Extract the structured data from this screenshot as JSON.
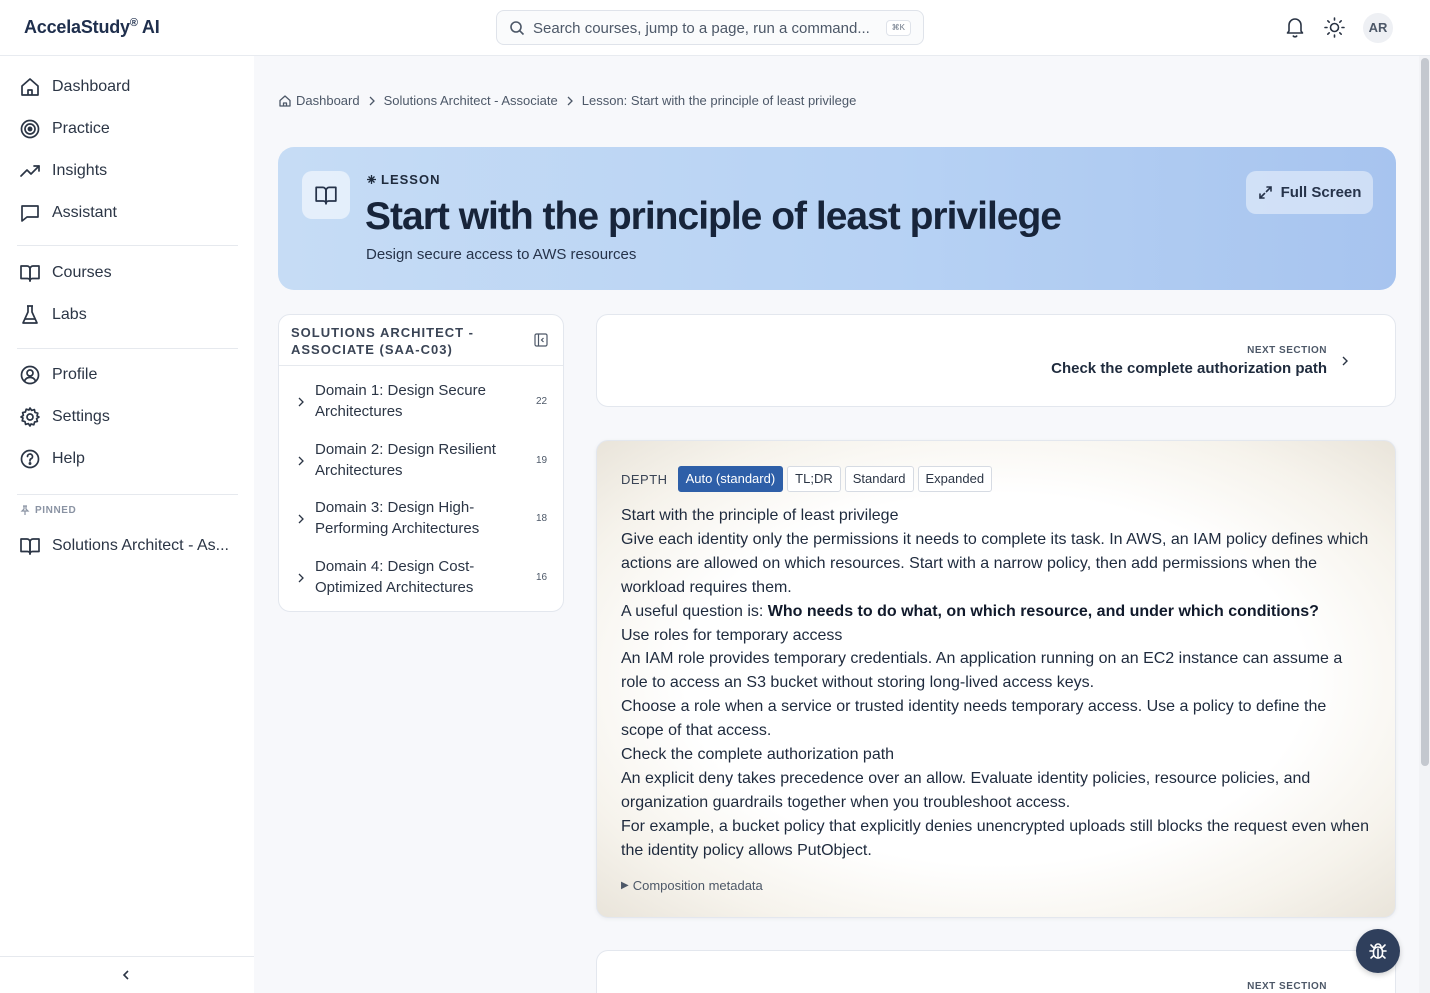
{
  "app": {
    "brand": "AccelaStudy",
    "brand_suffix": "AI",
    "registered": "®"
  },
  "search": {
    "placeholder": "Search courses, jump to a page, run a command...",
    "shortcut": "⌘K"
  },
  "topbar": {
    "avatar_initials": "AR"
  },
  "sidebar": {
    "primary": [
      {
        "label": "Dashboard",
        "icon": "home-icon"
      },
      {
        "label": "Practice",
        "icon": "target-icon"
      },
      {
        "label": "Insights",
        "icon": "trend-icon"
      },
      {
        "label": "Assistant",
        "icon": "chat-icon"
      }
    ],
    "secondary": [
      {
        "label": "Courses",
        "icon": "book-icon"
      },
      {
        "label": "Labs",
        "icon": "flask-icon"
      }
    ],
    "account": [
      {
        "label": "Profile",
        "icon": "user-circle-icon"
      },
      {
        "label": "Settings",
        "icon": "gear-icon"
      },
      {
        "label": "Help",
        "icon": "help-icon"
      }
    ],
    "pinned_label": "PINNED",
    "pinned": [
      {
        "label": "Solutions Architect - As...",
        "icon": "book-icon"
      }
    ]
  },
  "breadcrumb": {
    "items": [
      "Dashboard",
      "Solutions Architect - Associate",
      "Lesson: Start with the principle of least privilege"
    ]
  },
  "hero": {
    "kicker": "LESSON",
    "title": "Start with the principle of least privilege",
    "subtitle": "Design secure access to AWS resources",
    "fullscreen_label": "Full Screen"
  },
  "outline": {
    "title": "SOLUTIONS ARCHITECT - ASSOCIATE (SAA-C03)",
    "domains": [
      {
        "label": "Domain 1: Design Secure Architectures",
        "count": "22"
      },
      {
        "label": "Domain 2: Design Resilient Architectures",
        "count": "19"
      },
      {
        "label": "Domain 3: Design High-Performing Architectures",
        "count": "18"
      },
      {
        "label": "Domain 4: Design Cost-Optimized Architectures",
        "count": "16"
      }
    ]
  },
  "next_section": {
    "kicker": "NEXT SECTION",
    "title": "Check the complete authorization path"
  },
  "next_section_bottom": {
    "kicker": "NEXT SECTION"
  },
  "content": {
    "depth_label": "DEPTH",
    "depth_options": [
      "Auto (standard)",
      "TL;DR",
      "Standard",
      "Expanded"
    ],
    "depth_selected": "Auto (standard)",
    "lines": {
      "h1": "Start with the principle of least privilege",
      "p1": "Give each identity only the permissions it needs to complete its task. In AWS, an IAM policy defines which actions are allowed on which resources. Start with a narrow policy, then add permissions when the workload requires them.",
      "p2_prefix": "A useful question is: ",
      "p2_bold": "Who needs to do what, on which resource, and under which conditions?",
      "h2": "Use roles for temporary access",
      "p3": "An IAM role provides temporary credentials. An application running on an EC2 instance can assume a role to access an S3 bucket without storing long-lived access keys.",
      "p4": "Choose a role when a service or trusted identity needs temporary access. Use a policy to define the scope of that access.",
      "h3": "Check the complete authorization path",
      "p5": "An explicit deny takes precedence over an allow. Evaluate identity policies, resource policies, and organization guardrails together when you troubleshoot access.",
      "p6": "For example, a bucket policy that explicitly denies unencrypted uploads still blocks the request even when the identity policy allows PutObject."
    },
    "metadata_label": "Composition metadata"
  },
  "colors": {
    "accent": "#2e5fa8",
    "hero_start": "#c6dcf5",
    "hero_end": "#a7c4ef",
    "fab": "#2f3f5c"
  }
}
